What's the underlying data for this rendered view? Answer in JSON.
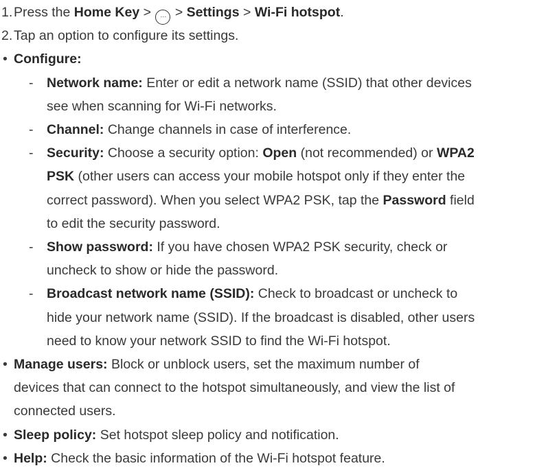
{
  "steps": [
    {
      "number": "1.",
      "parts": [
        {
          "t": "Press the ",
          "b": false
        },
        {
          "t": "Home Key",
          "b": true
        },
        {
          "t": " > ",
          "b": false
        },
        {
          "icon": "apps-icon",
          "glyph": "⋯"
        },
        {
          "t": " > ",
          "b": false
        },
        {
          "t": "Settings",
          "b": true
        },
        {
          "t": " > ",
          "b": false
        },
        {
          "t": "Wi-Fi hotspot",
          "b": true
        },
        {
          "t": ".",
          "b": false
        }
      ]
    },
    {
      "number": "2.",
      "parts": [
        {
          "t": "Tap an option to configure its settings.",
          "b": false
        }
      ]
    }
  ],
  "bullets": [
    {
      "label": "Configure:",
      "text": "",
      "sub": [
        {
          "lines": [
            [
              {
                "t": "Network name:",
                "b": true
              },
              {
                "t": " Enter or edit a network name (SSID) that other devices",
                "b": false
              }
            ],
            [
              {
                "t": "see when scanning for Wi-Fi networks.",
                "b": false
              }
            ]
          ]
        },
        {
          "lines": [
            [
              {
                "t": "Channel:",
                "b": true
              },
              {
                "t": " Change channels in case of interference.",
                "b": false
              }
            ]
          ]
        },
        {
          "lines": [
            [
              {
                "t": "Security:",
                "b": true
              },
              {
                "t": " Choose a security option: ",
                "b": false
              },
              {
                "t": "Open",
                "b": true
              },
              {
                "t": " (not recommended) or ",
                "b": false
              },
              {
                "t": "WPA2",
                "b": true
              }
            ],
            [
              {
                "t": "PSK",
                "b": true
              },
              {
                "t": " (other users can access your mobile hotspot only if they enter the",
                "b": false
              }
            ],
            [
              {
                "t": "correct password). When you select WPA2 PSK, tap the ",
                "b": false
              },
              {
                "t": "Password",
                "b": true
              },
              {
                "t": " field",
                "b": false
              }
            ],
            [
              {
                "t": "to edit the security password.",
                "b": false
              }
            ]
          ]
        },
        {
          "lines": [
            [
              {
                "t": "Show password:",
                "b": true
              },
              {
                "t": " If you have chosen WPA2 PSK security, check or",
                "b": false
              }
            ],
            [
              {
                "t": "uncheck to show or hide the password.",
                "b": false
              }
            ]
          ]
        },
        {
          "lines": [
            [
              {
                "t": "Broadcast network name (SSID):",
                "b": true
              },
              {
                "t": " Check to broadcast or uncheck to",
                "b": false
              }
            ],
            [
              {
                "t": "hide your network name (SSID). If the broadcast is disabled, other users",
                "b": false
              }
            ],
            [
              {
                "t": "need to know your network SSID to find the Wi-Fi hotspot.",
                "b": false
              }
            ]
          ]
        }
      ]
    },
    {
      "lines": [
        [
          {
            "t": "Manage users:",
            "b": true
          },
          {
            "t": " Block or unblock users, set the maximum number of",
            "b": false
          }
        ],
        [
          {
            "t": "devices that can connect to the hotspot simultaneously, and view the list of",
            "b": false
          }
        ],
        [
          {
            "t": "connected users.",
            "b": false
          }
        ]
      ]
    },
    {
      "lines": [
        [
          {
            "t": "Sleep policy:",
            "b": true
          },
          {
            "t": " Set hotspot sleep policy and notification.",
            "b": false
          }
        ]
      ]
    },
    {
      "lines": [
        [
          {
            "t": "Help:",
            "b": true
          },
          {
            "t": " Check the basic information of the Wi-Fi hotspot feature.",
            "b": false
          }
        ]
      ]
    }
  ],
  "markers": {
    "bullet": "•",
    "dash": "-"
  }
}
